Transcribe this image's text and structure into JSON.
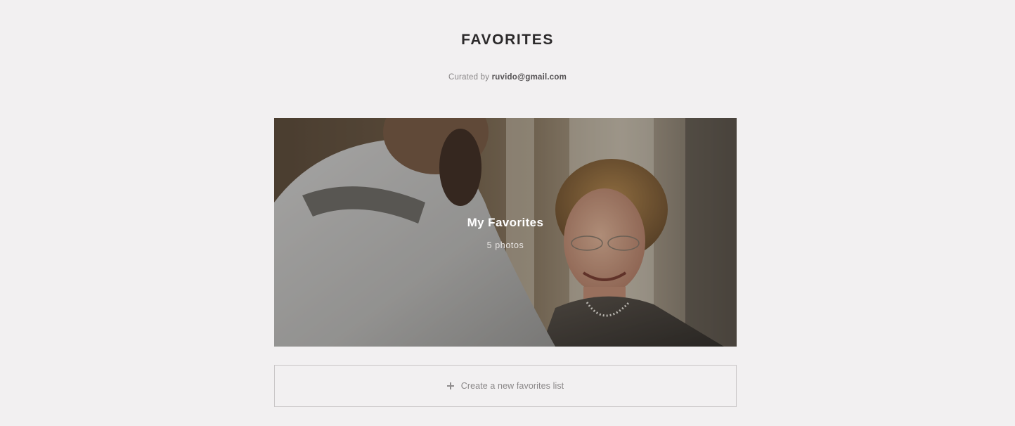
{
  "page": {
    "title": "FAVORITES",
    "curated_prefix": "Curated by",
    "curator": "ruvido@gmail.com"
  },
  "lists": [
    {
      "title": "My Favorites",
      "count_label": "5 photos"
    }
  ],
  "actions": {
    "create_label": "Create a new favorites list",
    "create_icon": "plus-icon"
  },
  "colors": {
    "background": "#f2f0f1",
    "title": "#2c2a2b",
    "muted_text": "#8a8788",
    "border": "#c9c6c7"
  }
}
